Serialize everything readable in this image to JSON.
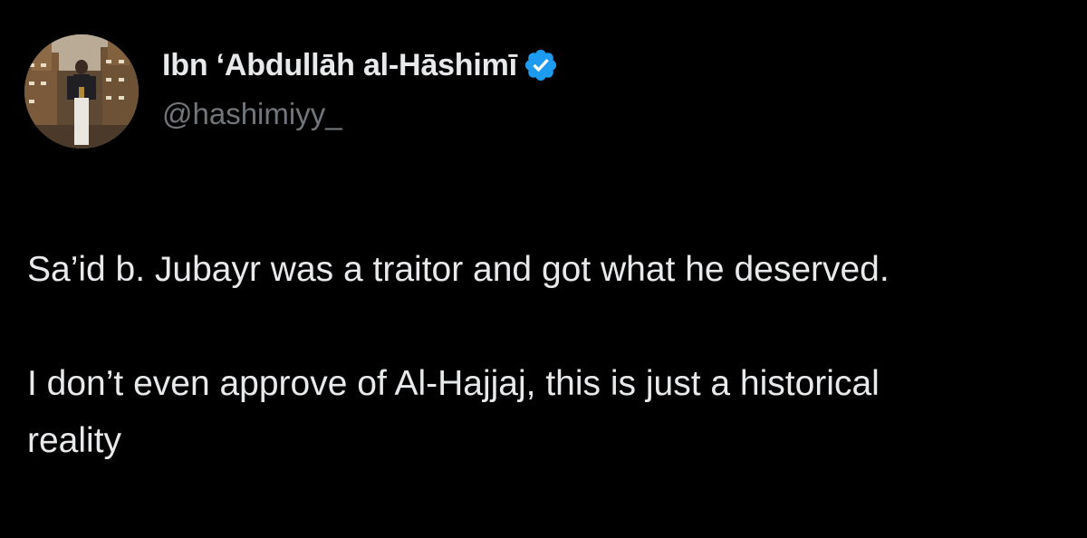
{
  "author": {
    "display_name": "Ibn ‘Abdullāh al-Hāshimī",
    "handle": "@hashimiyy_",
    "verified": true,
    "verified_icon": "verified-badge-icon",
    "avatar": "profile-photo"
  },
  "tweet": {
    "paragraphs": [
      "Sa’id b. Jubayr was a traitor and got what he deserved.",
      "I don’t even approve of Al-Hajjaj, this is just a historical reality"
    ]
  },
  "colors": {
    "background": "#000000",
    "text": "#e7e9ea",
    "secondary_text": "#71767b",
    "verified_blue": "#1d9bf0"
  }
}
